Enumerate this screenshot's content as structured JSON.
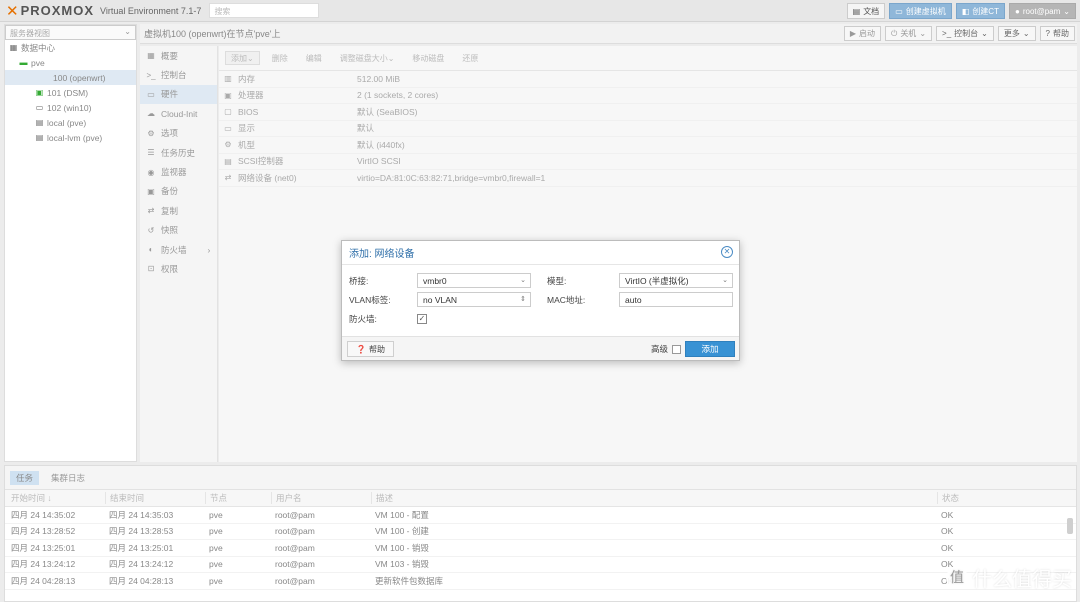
{
  "topbar": {
    "logo_text": "PROXMOX",
    "version": "Virtual Environment 7.1-7",
    "search_placeholder": "搜索",
    "buttons": [
      {
        "icon": "doc-icon",
        "label": "文档"
      },
      {
        "icon": "monitor-icon",
        "label": "创建虚拟机"
      },
      {
        "icon": "cube-icon",
        "label": "创建CT"
      },
      {
        "icon": "user-icon",
        "label": "root@pam"
      }
    ]
  },
  "sidebar": {
    "view_selector": "服务器视图",
    "tree": [
      {
        "icon": "datacenter-icon",
        "label": "数据中心"
      },
      {
        "icon": "node-icon",
        "label": "pve"
      },
      {
        "icon": "vm-icon",
        "label": "100 (openwrt)"
      },
      {
        "icon": "vm-running-icon",
        "label": "101 (DSM)"
      },
      {
        "icon": "vm-icon",
        "label": "102 (win10)"
      },
      {
        "icon": "storage-icon",
        "label": "local (pve)"
      },
      {
        "icon": "storage-icon",
        "label": "local-lvm (pve)"
      }
    ]
  },
  "crumbbar": {
    "title": "虚拟机100 (openwrt)在节点'pve'上",
    "buttons": [
      {
        "icon": "play-icon",
        "label": "启动"
      },
      {
        "icon": "power-icon",
        "label": "关机"
      },
      {
        "icon": "console-icon",
        "label": "控制台"
      },
      {
        "icon": "",
        "label": "更多"
      },
      {
        "icon": "help-icon",
        "label": "帮助"
      }
    ]
  },
  "menu": [
    {
      "icon": "summary-icon",
      "label": "概要"
    },
    {
      "icon": "console-icon",
      "label": "控制台"
    },
    {
      "icon": "monitor-icon",
      "label": "硬件"
    },
    {
      "icon": "cloud-icon",
      "label": "Cloud-Init"
    },
    {
      "icon": "gear-icon",
      "label": "选项"
    },
    {
      "icon": "list-icon",
      "label": "任务历史"
    },
    {
      "icon": "eye-icon",
      "label": "监视器"
    },
    {
      "icon": "save-icon",
      "label": "备份"
    },
    {
      "icon": "retweet-icon",
      "label": "复制"
    },
    {
      "icon": "history-icon",
      "label": "快照"
    },
    {
      "icon": "shield-icon",
      "label": "防火墙"
    },
    {
      "icon": "unlock-icon",
      "label": "权限"
    }
  ],
  "toolbar": {
    "buttons": [
      "添加",
      "删除",
      "编辑",
      "调整磁盘大小",
      "移动磁盘",
      "还原"
    ]
  },
  "hardware": [
    {
      "icon": "memory-icon",
      "name": "内存",
      "value": "512.00 MiB"
    },
    {
      "icon": "cpu-icon",
      "name": "处理器",
      "value": "2 (1 sockets, 2 cores)"
    },
    {
      "icon": "chip-icon",
      "name": "BIOS",
      "value": "默认 (SeaBIOS)"
    },
    {
      "icon": "desktop-icon",
      "name": "显示",
      "value": "默认"
    },
    {
      "icon": "cogs-icon",
      "name": "机型",
      "value": "默认 (i440fx)"
    },
    {
      "icon": "database-icon",
      "name": "SCSI控制器",
      "value": "VirtIO SCSI"
    },
    {
      "icon": "exchange-icon",
      "name": "网络设备 (net0)",
      "value": "virtio=DA:81:0C:63:82:71,bridge=vmbr0,firewall=1"
    }
  ],
  "dialog": {
    "title": "添加: 网络设备",
    "bridge_label": "桥接:",
    "bridge_value": "vmbr0",
    "model_label": "模型:",
    "model_value": "VirtIO (半虚拟化)",
    "vlan_label": "VLAN标签:",
    "vlan_value": "no VLAN",
    "mac_label": "MAC地址:",
    "mac_value": "auto",
    "firewall_label": "防火墙:",
    "firewall_checked": true,
    "help_label": "帮助",
    "advanced_label": "高级",
    "add_label": "添加"
  },
  "tasks": {
    "tabs": [
      "任务",
      "集群日志"
    ],
    "columns": [
      "开始时间 ↓",
      "结束时间",
      "节点",
      "用户名",
      "描述",
      "状态"
    ],
    "rows": [
      [
        "四月 24 14:35:02",
        "四月 24 14:35:03",
        "pve",
        "root@pam",
        "VM 100 - 配置",
        "OK"
      ],
      [
        "四月 24 13:28:52",
        "四月 24 13:28:53",
        "pve",
        "root@pam",
        "VM 100 - 创建",
        "OK"
      ],
      [
        "四月 24 13:25:01",
        "四月 24 13:25:01",
        "pve",
        "root@pam",
        "VM 100 - 销毁",
        "OK"
      ],
      [
        "四月 24 13:24:12",
        "四月 24 13:24:12",
        "pve",
        "root@pam",
        "VM 103 - 销毁",
        "OK"
      ],
      [
        "四月 24 04:28:13",
        "四月 24 04:28:13",
        "pve",
        "root@pam",
        "更新软件包数据库",
        "OK"
      ]
    ]
  },
  "watermark": {
    "text": "什么值得买",
    "mark": "值"
  },
  "colors": {
    "accent": "#3892d4",
    "brand_orange": "#e57000",
    "selection": "#dfe9f3"
  }
}
